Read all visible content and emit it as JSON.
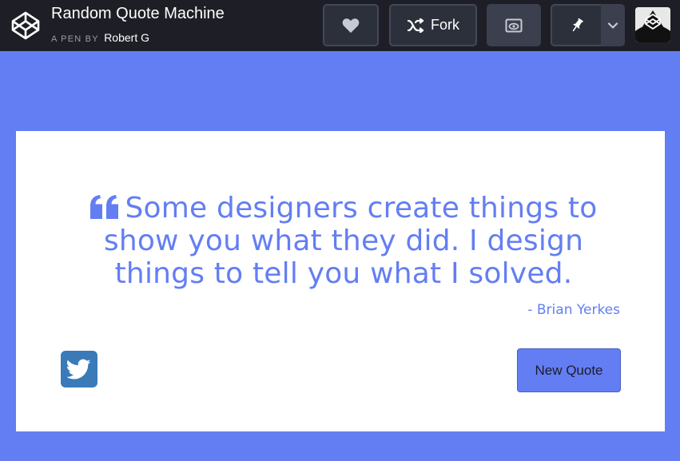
{
  "header": {
    "title": "Random Quote Machine",
    "byline_prefix": "A PEN BY",
    "author": "Robert G",
    "fork_label": "Fork"
  },
  "quote": {
    "text": "Some designers create things to show you what they did. I design things to tell you what I solved.",
    "author": "- Brian Yerkes"
  },
  "actions": {
    "new_quote_label": "New Quote"
  },
  "colors": {
    "accent": "#637ef3",
    "header_bg": "#1e1f26",
    "twitter": "#3a7ab8"
  },
  "icons": {
    "logo": "codepen-logo-icon",
    "heart": "heart-icon",
    "fork": "fork-icon",
    "view": "eye-icon",
    "pin": "pin-icon",
    "caret": "chevron-down-icon",
    "quote": "quote-left-icon",
    "twitter": "twitter-icon"
  }
}
